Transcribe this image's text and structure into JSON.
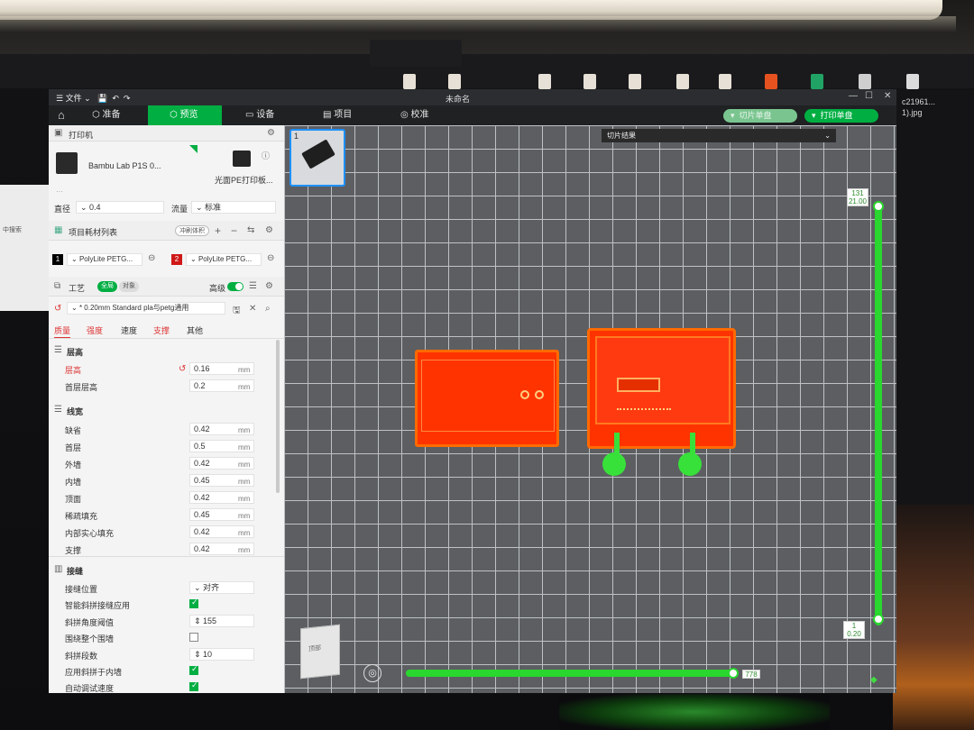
{
  "window": {
    "title": "未命名",
    "menu_file": "文件",
    "controls": [
      "—",
      "☐",
      "✕"
    ]
  },
  "tabs": {
    "prepare": "准备",
    "preview": "预览",
    "device": "设备",
    "project": "项目",
    "calibrate": "校准"
  },
  "toolbar": {
    "slice_plate": "切片单盘",
    "print_plate": "打印单盘"
  },
  "printer": {
    "section_label": "打印机",
    "name": "Bambu Lab P1S 0...",
    "plate_type": "光面PE打印板...",
    "nozzle_label": "直径",
    "nozzle_value": "0.4",
    "flow_label": "流量",
    "flow_value": "标准"
  },
  "filament": {
    "section_label": "项目耗材列表",
    "flush_button": "冲刷体积",
    "slots": [
      {
        "index": "1",
        "name": "PolyLite PETG...",
        "color": "#000000"
      },
      {
        "index": "2",
        "name": "PolyLite PETG...",
        "color": "#d01818"
      }
    ]
  },
  "process": {
    "section_label": "工艺",
    "mode_global": "全局",
    "mode_object": "对象",
    "advanced_label": "高级",
    "advanced_on": true,
    "preset": "* 0.20mm Standard  pla与petg通用",
    "subtabs": [
      "质量",
      "强度",
      "速度",
      "支撑",
      "其他"
    ]
  },
  "layer_height": {
    "group_label": "层高",
    "rows": [
      {
        "label": "层高",
        "value": "0.16",
        "unit": "mm",
        "modified": true
      },
      {
        "label": "首层层高",
        "value": "0.2",
        "unit": "mm",
        "modified": false
      }
    ]
  },
  "line_width": {
    "group_label": "线宽",
    "rows": [
      {
        "label": "缺省",
        "value": "0.42",
        "unit": "mm"
      },
      {
        "label": "首层",
        "value": "0.5",
        "unit": "mm"
      },
      {
        "label": "外墙",
        "value": "0.42",
        "unit": "mm"
      },
      {
        "label": "内墙",
        "value": "0.45",
        "unit": "mm"
      },
      {
        "label": "顶面",
        "value": "0.42",
        "unit": "mm"
      },
      {
        "label": "稀疏填充",
        "value": "0.45",
        "unit": "mm"
      },
      {
        "label": "内部实心填充",
        "value": "0.42",
        "unit": "mm"
      },
      {
        "label": "支撑",
        "value": "0.42",
        "unit": "mm"
      }
    ]
  },
  "seam": {
    "group_label": "接缝",
    "position_label": "接缝位置",
    "position_value": "对齐",
    "smart_scarf_label": "智能斜拼接缝应用",
    "smart_scarf_checked": true,
    "scarf_angle_label": "斜拼角度阈值",
    "scarf_angle_value": "155",
    "whole_wall_label": "围绕整个围墙",
    "whole_wall_checked": false,
    "scarf_steps_label": "斜拼段数",
    "scarf_steps_value": "10",
    "inner_wall_label": "应用斜拼于内墙",
    "inner_wall_checked": true,
    "auto_speed_label": "自动调试速度",
    "auto_speed_checked": true
  },
  "viewport": {
    "plate_number": "1",
    "slice_result_label": "切片结果",
    "layer_top_count": "131",
    "layer_top_height": "21.00",
    "layer_bottom_count": "1",
    "layer_bottom_height": "0.20",
    "move_progress": "778",
    "mini_label": "顶部"
  },
  "desktop": {
    "file_label_1": "c21961...",
    "file_label_2": "1).jpg",
    "left_search": "中搜索"
  }
}
